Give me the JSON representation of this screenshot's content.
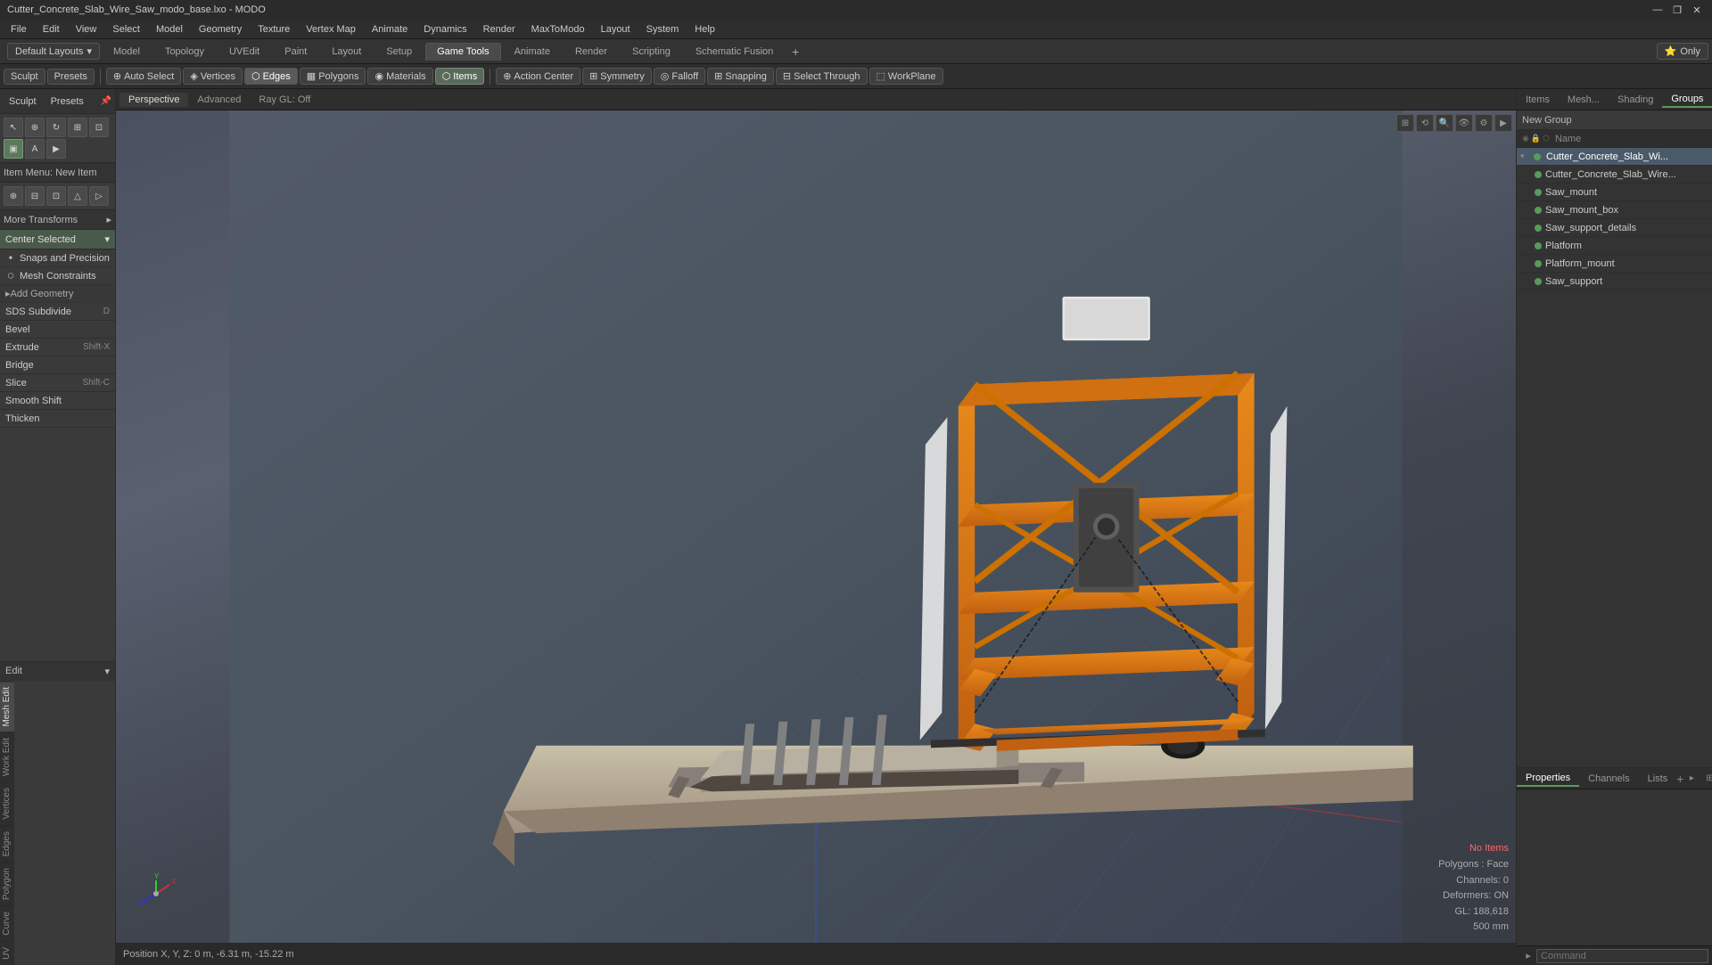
{
  "window": {
    "title": "Cutter_Concrete_Slab_Wire_Saw_modo_base.lxo - MODO"
  },
  "titlebar": {
    "title": "Cutter_Concrete_Slab_Wire_Saw_modo_base.lxo - MODO",
    "controls": [
      "—",
      "❐",
      "✕"
    ]
  },
  "menubar": {
    "items": [
      "File",
      "Edit",
      "View",
      "Select",
      "Model",
      "Geometry",
      "Texture",
      "Vertex Map",
      "Animate",
      "Dynamics",
      "Render",
      "MaxToModo",
      "Layout",
      "System",
      "Help"
    ]
  },
  "top_toolbar": {
    "layouts_label": "Default Layouts",
    "tabs": [
      "Model",
      "Topology",
      "UVEdit",
      "Paint",
      "Layout",
      "Setup",
      "Game Tools",
      "Animate",
      "Render",
      "Scripting",
      "Schematic Fusion"
    ],
    "active_tab": "Game Tools",
    "add_btn": "+",
    "only_btn": "⭐ Only"
  },
  "main_toolbar": {
    "sculpt_label": "Sculpt",
    "presets_label": "Presets",
    "auto_select": "Auto Select",
    "vertices": "Vertices",
    "edges": "Edges",
    "polygons": "Polygons",
    "materials": "Materials",
    "items": "Items",
    "action_center": "Action Center",
    "symmetry": "Symmetry",
    "falloff": "Falloff",
    "snapping": "Snapping",
    "select_through": "Select Through",
    "workplane": "WorkPlane"
  },
  "viewport": {
    "perspective": "Perspective",
    "advanced": "Advanced",
    "ray_gl": "Ray GL: Off",
    "subtabs": [
      "Perspective",
      "Advanced",
      "Ray GL: Off"
    ]
  },
  "left_panel": {
    "sculpt_label": "Sculpt",
    "presets_label": "Presets",
    "tool_sections": {
      "item_menu": "Item Menu: New Item",
      "more_transforms": "More Transforms",
      "center_selected": "Center Selected",
      "snaps_precision": "Snaps and Precision",
      "mesh_constraints": "Mesh Constraints",
      "add_geometry": "Add Geometry",
      "tools": [
        {
          "name": "SDS Subdivide",
          "shortcut": "D"
        },
        {
          "name": "Bevel",
          "shortcut": ""
        },
        {
          "name": "Extrude",
          "shortcut": "Shift-X"
        },
        {
          "name": "Bridge",
          "shortcut": ""
        },
        {
          "name": "Slice",
          "shortcut": "Shift-C"
        },
        {
          "name": "Smooth Shift",
          "shortcut": ""
        },
        {
          "name": "Thicken",
          "shortcut": ""
        }
      ]
    },
    "edit_label": "Edit",
    "vert_tabs": [
      "Mesh Edit",
      "Work Edit",
      "Vertices",
      "Edges",
      "Polygon",
      "Curve",
      "UV"
    ]
  },
  "right_panel": {
    "tabs": [
      "Items",
      "Mesh...",
      "Shading",
      "Groups"
    ],
    "active_tab": "Groups",
    "icons": [
      "⊞",
      "⊟",
      "◨",
      "⊡"
    ],
    "new_group_label": "New Group",
    "name_header": "Name",
    "scene_items": [
      {
        "name": "Cutter_Concrete_Slab_Wi...",
        "indent": 0,
        "selected": true,
        "has_expand": true
      },
      {
        "name": "Cutter_Concrete_Slab_Wire...",
        "indent": 1,
        "selected": false
      },
      {
        "name": "Saw_mount",
        "indent": 1,
        "selected": false
      },
      {
        "name": "Saw_mount_box",
        "indent": 1,
        "selected": false
      },
      {
        "name": "Saw_support_details",
        "indent": 1,
        "selected": false
      },
      {
        "name": "Platform",
        "indent": 1,
        "selected": false
      },
      {
        "name": "Platform_mount",
        "indent": 1,
        "selected": false
      },
      {
        "name": "Saw_support",
        "indent": 1,
        "selected": false
      }
    ],
    "bottom_tabs": [
      "Properties",
      "Channels",
      "Lists"
    ],
    "active_bottom_tab": "Properties",
    "command_placeholder": "Command"
  },
  "status": {
    "position": "Position X, Y, Z:  0 m, -6.31 m, -15.22 m",
    "no_items": "No Items",
    "polygons": "Polygons : Face",
    "channels": "Channels: 0",
    "deformers": "Deformers: ON",
    "gl": "GL: 188,618",
    "distance": "500 mm"
  },
  "icons": {
    "expand_arrow": "▸",
    "collapse_arrow": "▾",
    "chevron_down": "▾",
    "star": "⭐",
    "eye": "◉",
    "lock": "🔒",
    "mesh": "⬡",
    "add": "+",
    "close": "✕",
    "minimize": "—",
    "maximize": "❐",
    "settings": "⚙",
    "camera": "📷"
  }
}
